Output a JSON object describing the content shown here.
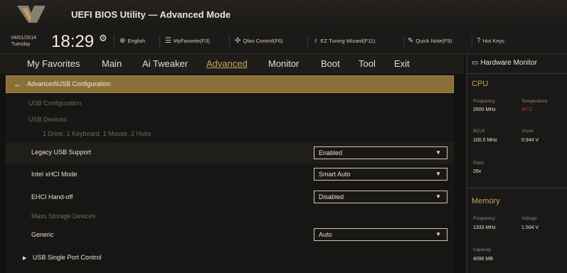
{
  "title": "UEFI BIOS Utility — Advanced Mode",
  "datetime": {
    "date": "04/01/2014",
    "day": "Tuesday",
    "time": "18:29"
  },
  "toolbar": {
    "language": "English",
    "favorites": "MyFavorite(F3)",
    "qfan": "Qfan Control(F6)",
    "ez_tuning": "EZ Tuning Wizard(F11)",
    "quick_note": "Quick Note(F9)",
    "hot_keys": "Hot Keys"
  },
  "tabs": [
    "My Favorites",
    "Main",
    "Ai Tweaker",
    "Advanced",
    "Monitor",
    "Boot",
    "Tool",
    "Exit"
  ],
  "active_tab": "Advanced",
  "breadcrumb": "Advanced\\USB Configuration",
  "settings": {
    "usb_config": "USB Configuration",
    "usb_devices": "USB Devices:",
    "devices_summary": "1 Drive, 1 Keyboard, 1 Mouse, 2 Hubs",
    "legacy_label": "Legacy USB Support",
    "legacy_value": "Enabled",
    "xhci_label": "Intel xHCI Mode",
    "xhci_value": "Smart Auto",
    "ehci_label": "EHCI Hand-off",
    "ehci_value": "Disabled",
    "mass_storage": "Mass Storage Devices:",
    "generic_label": "Generic",
    "generic_value": "Auto",
    "single_port": "USB Single Port Control"
  },
  "hardware_monitor": {
    "title": "Hardware Monitor",
    "cpu": {
      "label": "CPU",
      "frequency_label": "Frequency",
      "frequency": "2600 MHz",
      "temperature_label": "Temperature",
      "temperature": "40°C",
      "bclk_label": "BCLK",
      "bclk": "100.0 MHz",
      "vcore_label": "Vcore",
      "vcore": "0.944 V",
      "ratio_label": "Ratio",
      "ratio": "26x"
    },
    "memory": {
      "label": "Memory",
      "frequency_label": "Frequency",
      "frequency": "1333 MHz",
      "voltage_label": "Voltage",
      "voltage": "1.504 V",
      "capacity_label": "Capacity",
      "capacity": "4096 MB"
    }
  },
  "colors": {
    "accent": "#c9a35a",
    "breadcrumb": "#8a7038",
    "temperature": "#c23a3a"
  }
}
